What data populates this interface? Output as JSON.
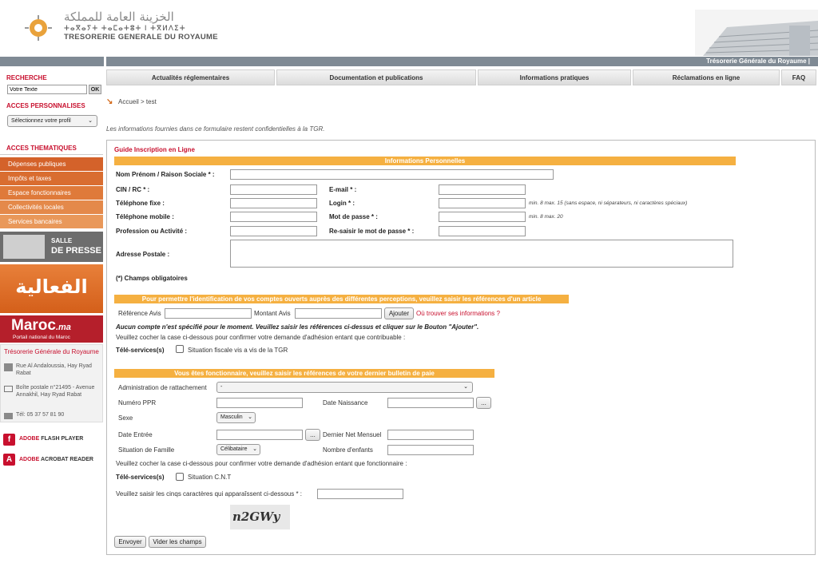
{
  "header": {
    "logo_arabic": "الخزينة العامة للمملكة",
    "logo_tifinagh": "ⵜⴰⴳⴰⵢⵜ ⵜⴰⵎⴰⵜⵓⵜ ⵏ ⵜⴳⵍⴷⵉⵜ",
    "logo_french": "TRESORERIE GENERALE DU ROYAUME",
    "topbar_title": "Trésorerie Générale du Royaume  |"
  },
  "nav": [
    "Actualités réglementaires",
    "Documentation et publications",
    "Informations pratiques",
    "Réclamations en ligne",
    "FAQ"
  ],
  "sidebar": {
    "search_title": "RECHERCHE",
    "search_value": "Votre Texte",
    "ok_label": "OK",
    "perso_title": "ACCES PERSONNALISES",
    "profile_select": "Sélectionnez votre profil",
    "theme_title": "ACCES THEMATIQUES",
    "themes": [
      "Dépenses publiques",
      "Impôts et taxes",
      "Espace fonctionnaires",
      "Collectivités locales",
      "Services bancaires"
    ],
    "salle_line1": "SALLE",
    "salle_line2": "DE PRESSE",
    "alfaaliya": "الفعالية",
    "maroc_title": "Maroc",
    "maroc_suffix": ".ma",
    "maroc_sub": "Portail national du Maroc",
    "tgr_title": "Trésorerie Générale du Royaume",
    "address": "Rue Al Andaloussia, Hay Ryad Rabat",
    "postbox": "Boîte postale n°21495 - Avenue Annakhil, Hay Ryad Rabat",
    "phone": "Tél: 05 37 57 81 90",
    "adobe_flash_a": "ADOBE",
    "adobe_flash_b": "FLASH PLAYER",
    "adobe_reader_a": "ADOBE",
    "adobe_reader_b": "ACROBAT READER"
  },
  "breadcrumb": "Accueil > test",
  "notice": "Les informations fournies dans ce formulaire restent confidentielles à la TGR.",
  "form": {
    "guide": "Guide Inscription en Ligne",
    "section_perso": "Informations Personnelles",
    "nom": "Nom Prénom / Raison Sociale * :",
    "cin": "CIN / RC * :",
    "email": "E-mail * :",
    "tel_fixe": "Téléphone fixe :",
    "login": "Login * :",
    "login_hint": "min. 8 max. 15 (sans espace, ni séparateurs, ni caractères spéciaux)",
    "tel_mobile": "Téléphone mobile :",
    "mdp": "Mot de passe * :",
    "mdp_hint": "min. 8 max. 20",
    "profession": "Profession ou Activité :",
    "remdp": "Re-saisir le mot de passe * :",
    "adresse": "Adresse Postale :",
    "obligatoires": "(*) Champs obligatoires",
    "section_comptes": "Pour permettre l'identification de vos comptes ouverts auprès des différentes perceptions, veuillez saisir les références d'un article",
    "ref_avis": "Référence Avis",
    "montant_avis": "Montant Avis",
    "ajouter": "Ajouter",
    "ou_trouver": "Où trouver ses informations ?",
    "aucun_compte": "Aucun compte n'est spécifié pour le moment. Veuillez saisir les références ci-dessus et cliquer sur le Bouton \"Ajouter\".",
    "cocher_contrib": "Veuillez cocher la case ci-dessous pour confirmer votre demande d'adhésion entant que contribuable :",
    "teleservices": "Télé-services(s)",
    "situation_fiscale": "Situation fiscale vis a vis de la TGR",
    "section_fonct": "Vous êtes fonctionnaire, veuillez saisir les références de votre dernier bulletin de paie",
    "admin": "Administration de rattachement",
    "admin_value": "-",
    "ppr": "Numéro PPR",
    "naissance": "Date Naissance",
    "dots": "...",
    "sexe": "Sexe",
    "sexe_value": "Masculin",
    "date_entree": "Date Entrée",
    "net_mensuel": "Dernier Net Mensuel",
    "situation_famille": "Situation de Famille",
    "famille_value": "Célibataire",
    "nb_enfants": "Nombre d'enfants",
    "cocher_fonct": "Veuillez cocher la case ci-dessous pour confirmer votre demande d'adhésion entant que fonctionnaire :",
    "teleservices2": "Télé-services(s)",
    "situation_cnt": "Situation C.N.T",
    "captcha_label": "Veuillez saisir les cinqs caractères qui apparaîssent ci-dessous * :",
    "captcha_text": "n2GWy",
    "envoyer": "Envoyer",
    "vider": "Vider les champs"
  }
}
